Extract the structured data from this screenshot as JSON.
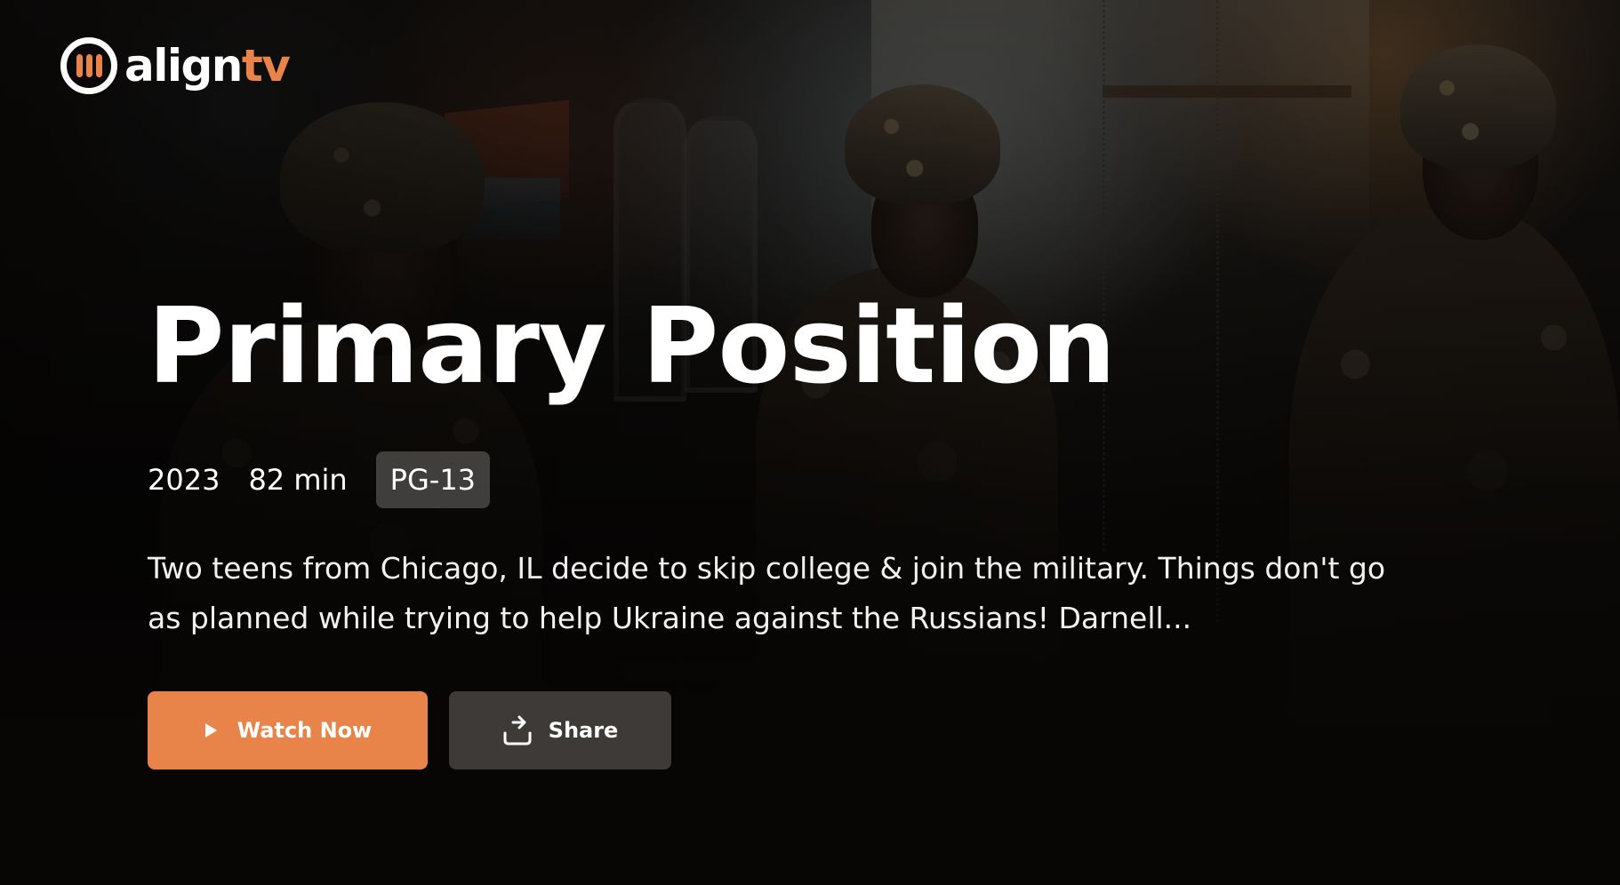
{
  "brand": {
    "name_part1": "align",
    "name_part2": "tv",
    "accent_color": "#e8844a"
  },
  "hero": {
    "title": "Primary Position",
    "year": "2023",
    "runtime": "82 min",
    "rating": "PG-13",
    "description": "Two teens from Chicago, IL decide to skip college & join the military. Things don't go as planned while trying to help Ukraine against the Russians! Darnell...",
    "backdrop": "three soldiers in camouflage helmets in a dim room"
  },
  "actions": {
    "watch_label": "Watch Now",
    "watch_icon": "play-icon",
    "share_label": "Share",
    "share_icon": "share-icon"
  }
}
